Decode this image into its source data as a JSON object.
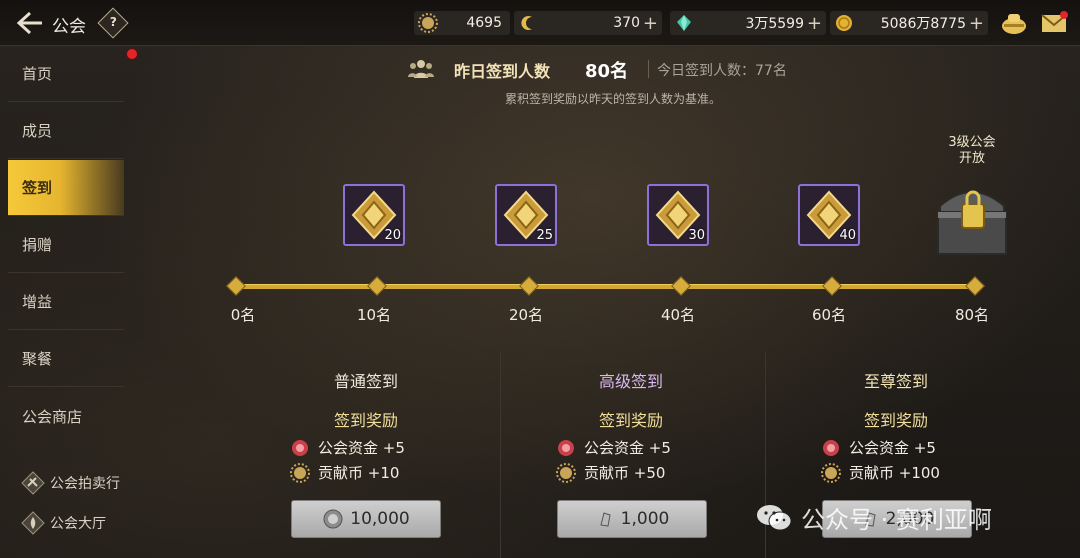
{
  "header": {
    "title": "公会",
    "help_label": "?",
    "resources": [
      {
        "icon": "sun-gear-icon",
        "value": "4695"
      },
      {
        "icon": "crescent-coin-icon",
        "value": "370"
      },
      {
        "icon": "green-gem-icon",
        "value": "3万5599"
      },
      {
        "icon": "gold-coin-icon",
        "value": "5086万8775"
      }
    ]
  },
  "sidebar": {
    "items": [
      {
        "label": "首页"
      },
      {
        "label": "成员"
      },
      {
        "label": "签到",
        "active": true
      },
      {
        "label": "捐赠"
      },
      {
        "label": "增益"
      },
      {
        "label": "聚餐"
      },
      {
        "label": "公会商店"
      }
    ],
    "bottom": [
      {
        "label": "公会拍卖行"
      },
      {
        "label": "公会大厅"
      }
    ]
  },
  "stats": {
    "yesterday_label": "昨日签到人数",
    "yesterday_value": "80名",
    "today_text": "今日签到人数：77名",
    "note": "累积签到奖励以昨天的签到人数为基准。"
  },
  "progress": {
    "ticks": [
      "0名",
      "10名",
      "20名",
      "40名",
      "60名",
      "80名"
    ],
    "milestones": [
      {
        "count": "20"
      },
      {
        "count": "25"
      },
      {
        "count": "30"
      },
      {
        "count": "40"
      }
    ],
    "chest_label_1": "3级公会",
    "chest_label_2": "开放"
  },
  "columns": [
    {
      "title": "普通签到",
      "reward_title": "签到奖励",
      "rewards": [
        "公会资金 +5",
        "贡献币 +10"
      ],
      "cost": "10,000",
      "cost_icon": "silver-coin-icon"
    },
    {
      "title": "高级签到",
      "reward_title": "签到奖励",
      "rewards": [
        "公会资金 +5",
        "贡献币 +50"
      ],
      "cost": "1,000",
      "cost_icon": "crystal-icon"
    },
    {
      "title": "至尊签到",
      "reward_title": "签到奖励",
      "rewards": [
        "公会资金 +5",
        "贡献币 +100"
      ],
      "cost": "2,000",
      "cost_icon": "crystal-icon"
    }
  ],
  "watermark": "公众号 · 赛利亚啊",
  "colors": {
    "accent_gold": "#d4a732",
    "active_tab": "#f5c93a",
    "milestone_border": "#8f6fd8"
  }
}
